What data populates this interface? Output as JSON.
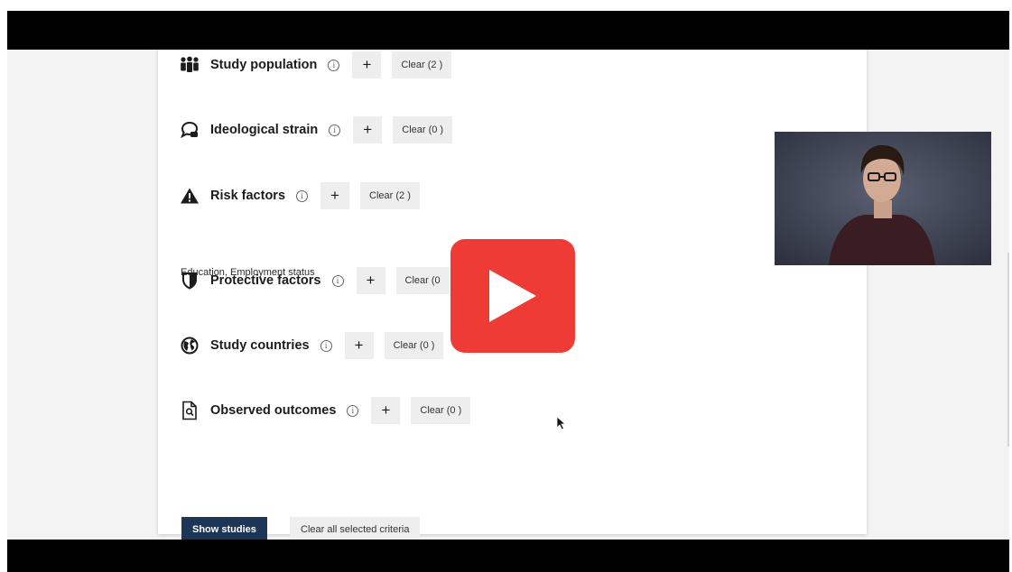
{
  "filters": [
    {
      "label": "Study population",
      "icon": "people-group-icon",
      "clear_label": "Clear (2 )"
    },
    {
      "label": "Ideological strain",
      "icon": "speech-bubble-icon",
      "clear_label": "Clear (0 )"
    },
    {
      "label": "Risk factors",
      "icon": "warning-triangle-icon",
      "clear_label": "Clear (2 )",
      "selected_text": "Education, Employment status"
    },
    {
      "label": "Protective factors",
      "icon": "shield-icon",
      "clear_label": "Clear (0"
    },
    {
      "label": "Study countries",
      "icon": "globe-icon",
      "clear_label": "Clear (0 )"
    },
    {
      "label": "Observed outcomes",
      "icon": "document-search-icon",
      "clear_label": "Clear (0 )"
    }
  ],
  "info_glyph": "i",
  "plus_glyph": "+",
  "actions": {
    "show_studies": "Show studies",
    "clear_all": "Clear all selected criteria"
  },
  "colors": {
    "primary_button": "#1d3557",
    "play_button": "#ee3b36",
    "chip_background": "#eeeeef"
  }
}
